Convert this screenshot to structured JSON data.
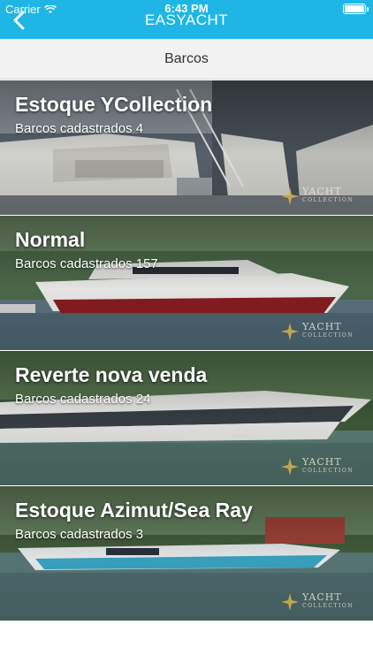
{
  "status_bar": {
    "carrier": "Carrier",
    "time": "6:43 PM"
  },
  "nav": {
    "title": "EASYACHT",
    "back_icon": "chevron-left-icon",
    "accent_color": "#1fb6e6"
  },
  "section": {
    "title": "Barcos"
  },
  "cards": [
    {
      "title": "Estoque YCollection",
      "subtitle": "Barcos cadastrados 4"
    },
    {
      "title": "Normal",
      "subtitle": "Barcos cadastrados 157"
    },
    {
      "title": "Reverte nova venda",
      "subtitle": "Barcos cadastrados 24"
    },
    {
      "title": "Estoque Azimut/Sea Ray",
      "subtitle": "Barcos cadastrados 3"
    }
  ],
  "watermark": {
    "icon": "star-logo-icon",
    "text_main": "YACHT",
    "text_sub": "COLLECTION"
  }
}
